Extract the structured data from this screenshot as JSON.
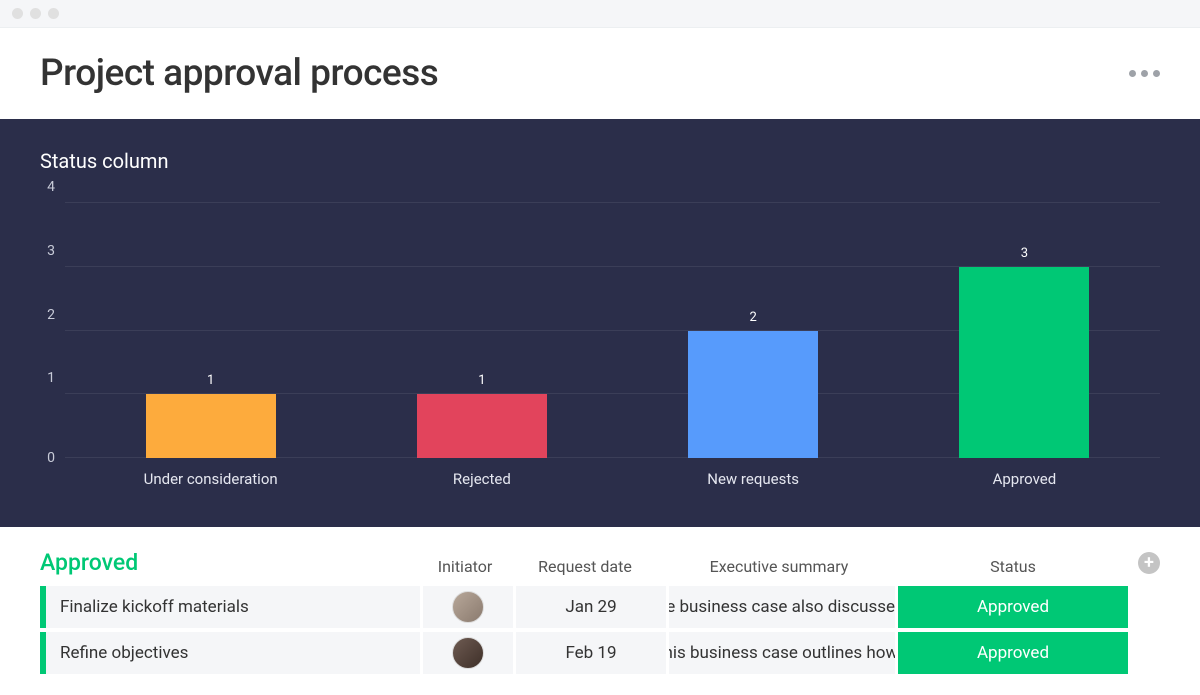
{
  "header": {
    "title": "Project approval process"
  },
  "chart_data": {
    "type": "bar",
    "title": "Status column",
    "categories": [
      "Under consideration",
      "Rejected",
      "New requests",
      "Approved"
    ],
    "values": [
      1,
      1,
      2,
      3
    ],
    "colors": [
      "#fdab3d",
      "#e2445c",
      "#579bfc",
      "#00c875"
    ],
    "y_ticks": [
      0,
      1,
      2,
      3,
      4
    ],
    "ylim": [
      0,
      4
    ],
    "xlabel": "",
    "ylabel": ""
  },
  "table": {
    "group_name": "Approved",
    "group_color": "#00c875",
    "columns": {
      "initiator": "Initiator",
      "request_date": "Request date",
      "executive_summary": "Executive summary",
      "status": "Status"
    },
    "rows": [
      {
        "name": "Finalize kickoff materials",
        "request_date": "Jan 29",
        "executive_summary": "The business case also discusses...",
        "status": "Approved",
        "status_color": "#00c875"
      },
      {
        "name": "Refine objectives",
        "request_date": "Feb 19",
        "executive_summary": "This business case outlines how...",
        "status": "Approved",
        "status_color": "#00c875"
      }
    ]
  }
}
